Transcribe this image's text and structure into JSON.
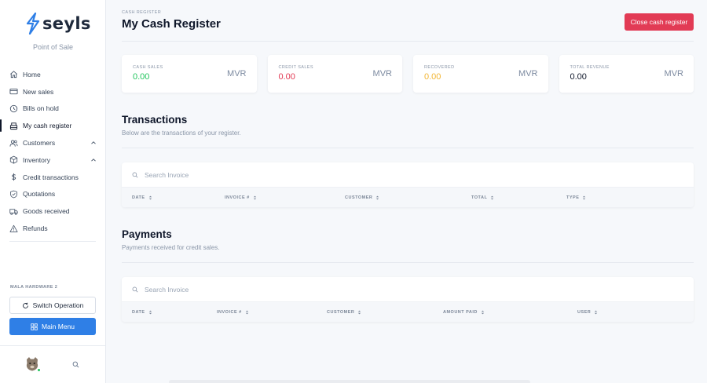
{
  "app": {
    "brand": "seyls",
    "tagline": "Point of Sale"
  },
  "sidebar": {
    "items": [
      {
        "label": "Home",
        "icon": "home-icon"
      },
      {
        "label": "New sales",
        "icon": "card-icon"
      },
      {
        "label": "Bills on hold",
        "icon": "clock-icon"
      },
      {
        "label": "My cash register",
        "icon": "register-icon",
        "active": true
      },
      {
        "label": "Customers",
        "icon": "users-icon",
        "expandable": true
      },
      {
        "label": "Inventory",
        "icon": "box-icon",
        "expandable": true
      },
      {
        "label": "Credit transactions",
        "icon": "dollar-icon"
      },
      {
        "label": "Quotations",
        "icon": "shield-icon"
      },
      {
        "label": "Goods received",
        "icon": "truck-icon"
      },
      {
        "label": "Refunds",
        "icon": "warning-icon"
      }
    ],
    "business_name": "MALA HARDWARE 2",
    "switch_label": "Switch Operation",
    "main_menu_label": "Main Menu"
  },
  "header": {
    "breadcrumb": "CASH REGISTER",
    "title": "My Cash Register",
    "close_label": "Close cash register"
  },
  "stats": [
    {
      "label": "CASH SALES",
      "value": "0.00",
      "currency": "MVR",
      "color": "#22c55e"
    },
    {
      "label": "CREDIT SALES",
      "value": "0.00",
      "currency": "MVR",
      "color": "#e23b55"
    },
    {
      "label": "RECOVERED",
      "value": "0.00",
      "currency": "MVR",
      "color": "#f2b533"
    },
    {
      "label": "TOTAL REVENUE",
      "value": "0.00",
      "currency": "MVR",
      "color": "#0f172a"
    }
  ],
  "transactions": {
    "title": "Transactions",
    "subtitle": "Below are the transactions of your register.",
    "search_placeholder": "Search Invoice",
    "columns": [
      "DATE",
      "INVOICE #",
      "CUSTOMER",
      "TOTAL",
      "TYPE"
    ]
  },
  "payments": {
    "title": "Payments",
    "subtitle": "Payments received for credit sales.",
    "search_placeholder": "Search Invoice",
    "columns": [
      "DATE",
      "INVOICE #",
      "CUSTOMER",
      "AMOUNT PAID",
      "USER"
    ]
  },
  "colors": {
    "primary": "#2f7fe6",
    "danger": "#e23b55"
  }
}
